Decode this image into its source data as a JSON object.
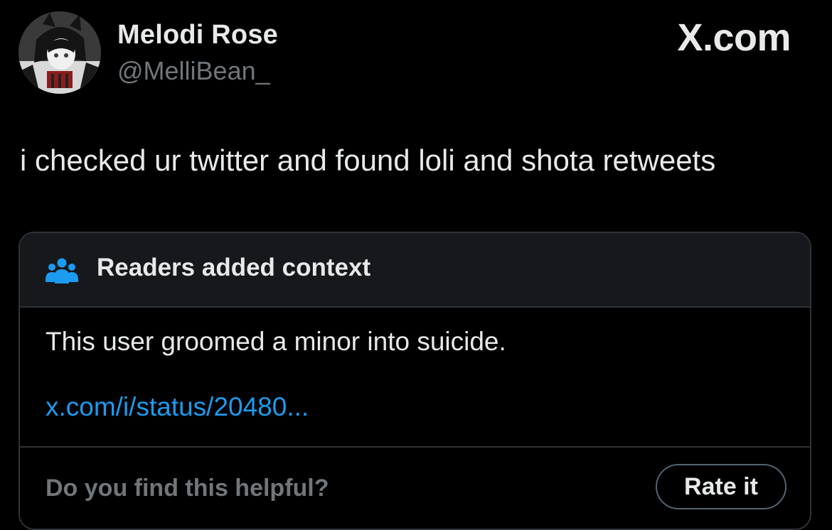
{
  "colors": {
    "background": "#000000",
    "primary_text": "#e7e9ea",
    "secondary_text": "#71767b",
    "link": "#1d9bf0",
    "border": "#2f3336",
    "note_header_bg": "#16181c",
    "people_icon": "#1d9bf0"
  },
  "brand": {
    "logo_text": "X.com"
  },
  "author": {
    "display_name": "Melodi Rose",
    "handle": "@MelliBean_",
    "avatar_icon": "avatar-image"
  },
  "tweet": {
    "text": "i checked ur twitter and found loli and shota retweets"
  },
  "community_note": {
    "icon": "people-icon",
    "title": "Readers added context",
    "body": "This user groomed a minor into suicide.",
    "link_text": "x.com/i/status/20480...",
    "helpful_question": "Do you find this helpful?",
    "rate_button_label": "Rate it"
  }
}
